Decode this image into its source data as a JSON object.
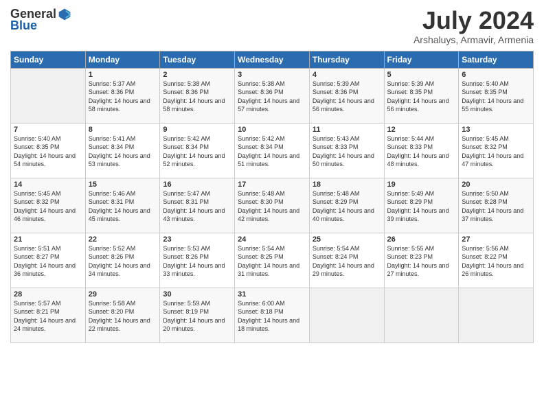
{
  "logo": {
    "general": "General",
    "blue": "Blue"
  },
  "title": {
    "month_year": "July 2024",
    "location": "Arshaluys, Armavir, Armenia"
  },
  "headers": [
    "Sunday",
    "Monday",
    "Tuesday",
    "Wednesday",
    "Thursday",
    "Friday",
    "Saturday"
  ],
  "weeks": [
    [
      {
        "day": "",
        "sunrise": "",
        "sunset": "",
        "daylight": ""
      },
      {
        "day": "1",
        "sunrise": "Sunrise: 5:37 AM",
        "sunset": "Sunset: 8:36 PM",
        "daylight": "Daylight: 14 hours and 58 minutes."
      },
      {
        "day": "2",
        "sunrise": "Sunrise: 5:38 AM",
        "sunset": "Sunset: 8:36 PM",
        "daylight": "Daylight: 14 hours and 58 minutes."
      },
      {
        "day": "3",
        "sunrise": "Sunrise: 5:38 AM",
        "sunset": "Sunset: 8:36 PM",
        "daylight": "Daylight: 14 hours and 57 minutes."
      },
      {
        "day": "4",
        "sunrise": "Sunrise: 5:39 AM",
        "sunset": "Sunset: 8:36 PM",
        "daylight": "Daylight: 14 hours and 56 minutes."
      },
      {
        "day": "5",
        "sunrise": "Sunrise: 5:39 AM",
        "sunset": "Sunset: 8:35 PM",
        "daylight": "Daylight: 14 hours and 56 minutes."
      },
      {
        "day": "6",
        "sunrise": "Sunrise: 5:40 AM",
        "sunset": "Sunset: 8:35 PM",
        "daylight": "Daylight: 14 hours and 55 minutes."
      }
    ],
    [
      {
        "day": "7",
        "sunrise": "Sunrise: 5:40 AM",
        "sunset": "Sunset: 8:35 PM",
        "daylight": "Daylight: 14 hours and 54 minutes."
      },
      {
        "day": "8",
        "sunrise": "Sunrise: 5:41 AM",
        "sunset": "Sunset: 8:34 PM",
        "daylight": "Daylight: 14 hours and 53 minutes."
      },
      {
        "day": "9",
        "sunrise": "Sunrise: 5:42 AM",
        "sunset": "Sunset: 8:34 PM",
        "daylight": "Daylight: 14 hours and 52 minutes."
      },
      {
        "day": "10",
        "sunrise": "Sunrise: 5:42 AM",
        "sunset": "Sunset: 8:34 PM",
        "daylight": "Daylight: 14 hours and 51 minutes."
      },
      {
        "day": "11",
        "sunrise": "Sunrise: 5:43 AM",
        "sunset": "Sunset: 8:33 PM",
        "daylight": "Daylight: 14 hours and 50 minutes."
      },
      {
        "day": "12",
        "sunrise": "Sunrise: 5:44 AM",
        "sunset": "Sunset: 8:33 PM",
        "daylight": "Daylight: 14 hours and 48 minutes."
      },
      {
        "day": "13",
        "sunrise": "Sunrise: 5:45 AM",
        "sunset": "Sunset: 8:32 PM",
        "daylight": "Daylight: 14 hours and 47 minutes."
      }
    ],
    [
      {
        "day": "14",
        "sunrise": "Sunrise: 5:45 AM",
        "sunset": "Sunset: 8:32 PM",
        "daylight": "Daylight: 14 hours and 46 minutes."
      },
      {
        "day": "15",
        "sunrise": "Sunrise: 5:46 AM",
        "sunset": "Sunset: 8:31 PM",
        "daylight": "Daylight: 14 hours and 45 minutes."
      },
      {
        "day": "16",
        "sunrise": "Sunrise: 5:47 AM",
        "sunset": "Sunset: 8:31 PM",
        "daylight": "Daylight: 14 hours and 43 minutes."
      },
      {
        "day": "17",
        "sunrise": "Sunrise: 5:48 AM",
        "sunset": "Sunset: 8:30 PM",
        "daylight": "Daylight: 14 hours and 42 minutes."
      },
      {
        "day": "18",
        "sunrise": "Sunrise: 5:48 AM",
        "sunset": "Sunset: 8:29 PM",
        "daylight": "Daylight: 14 hours and 40 minutes."
      },
      {
        "day": "19",
        "sunrise": "Sunrise: 5:49 AM",
        "sunset": "Sunset: 8:29 PM",
        "daylight": "Daylight: 14 hours and 39 minutes."
      },
      {
        "day": "20",
        "sunrise": "Sunrise: 5:50 AM",
        "sunset": "Sunset: 8:28 PM",
        "daylight": "Daylight: 14 hours and 37 minutes."
      }
    ],
    [
      {
        "day": "21",
        "sunrise": "Sunrise: 5:51 AM",
        "sunset": "Sunset: 8:27 PM",
        "daylight": "Daylight: 14 hours and 36 minutes."
      },
      {
        "day": "22",
        "sunrise": "Sunrise: 5:52 AM",
        "sunset": "Sunset: 8:26 PM",
        "daylight": "Daylight: 14 hours and 34 minutes."
      },
      {
        "day": "23",
        "sunrise": "Sunrise: 5:53 AM",
        "sunset": "Sunset: 8:26 PM",
        "daylight": "Daylight: 14 hours and 33 minutes."
      },
      {
        "day": "24",
        "sunrise": "Sunrise: 5:54 AM",
        "sunset": "Sunset: 8:25 PM",
        "daylight": "Daylight: 14 hours and 31 minutes."
      },
      {
        "day": "25",
        "sunrise": "Sunrise: 5:54 AM",
        "sunset": "Sunset: 8:24 PM",
        "daylight": "Daylight: 14 hours and 29 minutes."
      },
      {
        "day": "26",
        "sunrise": "Sunrise: 5:55 AM",
        "sunset": "Sunset: 8:23 PM",
        "daylight": "Daylight: 14 hours and 27 minutes."
      },
      {
        "day": "27",
        "sunrise": "Sunrise: 5:56 AM",
        "sunset": "Sunset: 8:22 PM",
        "daylight": "Daylight: 14 hours and 26 minutes."
      }
    ],
    [
      {
        "day": "28",
        "sunrise": "Sunrise: 5:57 AM",
        "sunset": "Sunset: 8:21 PM",
        "daylight": "Daylight: 14 hours and 24 minutes."
      },
      {
        "day": "29",
        "sunrise": "Sunrise: 5:58 AM",
        "sunset": "Sunset: 8:20 PM",
        "daylight": "Daylight: 14 hours and 22 minutes."
      },
      {
        "day": "30",
        "sunrise": "Sunrise: 5:59 AM",
        "sunset": "Sunset: 8:19 PM",
        "daylight": "Daylight: 14 hours and 20 minutes."
      },
      {
        "day": "31",
        "sunrise": "Sunrise: 6:00 AM",
        "sunset": "Sunset: 8:18 PM",
        "daylight": "Daylight: 14 hours and 18 minutes."
      },
      {
        "day": "",
        "sunrise": "",
        "sunset": "",
        "daylight": ""
      },
      {
        "day": "",
        "sunrise": "",
        "sunset": "",
        "daylight": ""
      },
      {
        "day": "",
        "sunrise": "",
        "sunset": "",
        "daylight": ""
      }
    ]
  ]
}
